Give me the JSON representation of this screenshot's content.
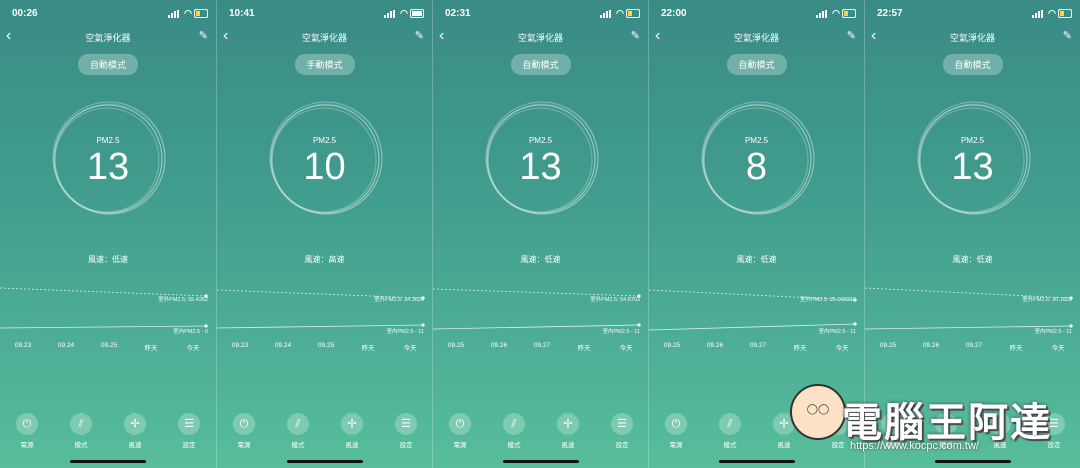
{
  "screens": [
    {
      "time": "00:26",
      "title": "空氣淨化器",
      "mode": "自動模式",
      "pm_label": "PM2.5",
      "pm_value": "13",
      "wind": "風速：低速",
      "outdoor": "室外PM2.5: 55.4262",
      "indoor": "室內PM2.5 - 0",
      "dates": [
        "09.23",
        "09.24",
        "09.25",
        "昨天",
        "今天"
      ],
      "battery": "low",
      "controls": [
        "電源",
        "模式",
        "風速",
        "設定"
      ]
    },
    {
      "time": "10:41",
      "title": "空氣淨化器",
      "mode": "手動模式",
      "pm_label": "PM2.5",
      "pm_value": "10",
      "wind": "風速：高速",
      "outdoor": "室外PM2.5: 34.3628",
      "indoor": "室內PM2.5 - 11",
      "dates": [
        "09.23",
        "09.24",
        "09.25",
        "昨天",
        "今天"
      ],
      "battery": "full",
      "controls": [
        "電源",
        "模式",
        "風速",
        "設定"
      ]
    },
    {
      "time": "02:31",
      "title": "空氣淨化器",
      "mode": "自動模式",
      "pm_label": "PM2.5",
      "pm_value": "13",
      "wind": "風速：低速",
      "outdoor": "室外PM2.5: 54.8703",
      "indoor": "室內PM2.5 - 11",
      "dates": [
        "09.25",
        "09.26",
        "09.27",
        "昨天",
        "今天"
      ],
      "battery": "low",
      "controls": [
        "電源",
        "模式",
        "風速",
        "設定"
      ]
    },
    {
      "time": "22:00",
      "title": "空氣淨化器",
      "mode": "自動模式",
      "pm_label": "PM2.5",
      "pm_value": "8",
      "wind": "風速：低速",
      "outdoor": "室外PM2.5: 25.009216",
      "indoor": "室內PM2.5 - 11",
      "dates": [
        "09.25",
        "09.26",
        "09.27",
        "昨天",
        "今天"
      ],
      "battery": "low",
      "controls": [
        "電源",
        "模式",
        "風速",
        "設定"
      ]
    },
    {
      "time": "22:57",
      "title": "空氣淨化器",
      "mode": "自動模式",
      "pm_label": "PM2.5",
      "pm_value": "13",
      "wind": "風速：低速",
      "outdoor": "室外PM2.5: 30.1623",
      "indoor": "室內PM2.5 - 11",
      "dates": [
        "09.25",
        "09.26",
        "09.27",
        "昨天",
        "今天"
      ],
      "battery": "low",
      "controls": [
        "電源",
        "模式",
        "風速",
        "設定"
      ]
    }
  ],
  "watermark": {
    "title": "電腦王阿達",
    "url": "https://www.kocpc.com.tw/"
  },
  "colors": {
    "bg_top": "#3a8b86",
    "bg_bottom": "#57bd9c",
    "battery_low": "#ffd43b"
  },
  "icons": [
    "back-chevron-icon",
    "edit-pencil-icon",
    "power-icon",
    "mode-icon",
    "fan-icon",
    "settings-icon"
  ]
}
